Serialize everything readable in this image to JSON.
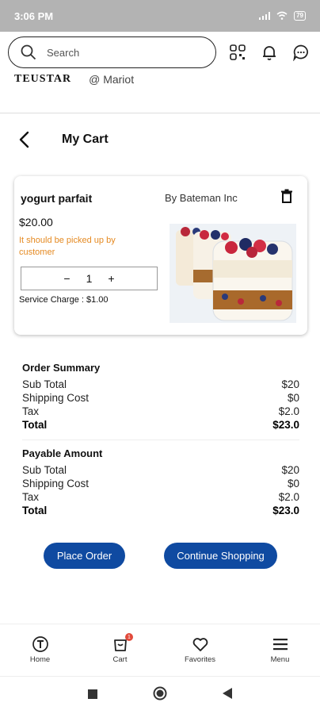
{
  "status": {
    "time": "3:06 PM",
    "battery": "79"
  },
  "search": {
    "placeholder": "Search"
  },
  "brand": {
    "logo_text": "TEUSTAR",
    "location": "@ Mariot"
  },
  "cart": {
    "title": "My Cart"
  },
  "item": {
    "name": "yogurt parfait",
    "vendor": "By Bateman Inc",
    "price": "$20.00",
    "note": "It should be picked up by customer",
    "quantity": "1",
    "service_charge": "Service Charge : $1.00",
    "image": "yogurt-parfait-photo"
  },
  "order_summary": {
    "heading": "Order Summary",
    "rows": [
      {
        "label": "Sub Total",
        "value": "$20"
      },
      {
        "label": "Shipping Cost",
        "value": "$0"
      },
      {
        "label": "Tax",
        "value": "$2.0"
      },
      {
        "label": "Total",
        "value": "$23.0"
      }
    ]
  },
  "payable": {
    "heading": "Payable Amount",
    "rows": [
      {
        "label": "Sub Total",
        "value": "$20"
      },
      {
        "label": "Shipping Cost",
        "value": "$0"
      },
      {
        "label": "Tax",
        "value": "$2.0"
      },
      {
        "label": "Total",
        "value": "$23.0"
      }
    ]
  },
  "buttons": {
    "place_order": "Place Order",
    "continue_shopping": "Continue Shopping"
  },
  "tabs": [
    {
      "label": "Home",
      "icon": "home-t-icon"
    },
    {
      "label": "Cart",
      "icon": "cart-icon",
      "badge": "1"
    },
    {
      "label": "Favorites",
      "icon": "heart-icon"
    },
    {
      "label": "Menu",
      "icon": "menu-icon"
    }
  ],
  "colors": {
    "primary": "#0f4aa1",
    "note": "#e58a22",
    "status_bar": "#b3b3b3",
    "badge": "#e24a3b"
  }
}
